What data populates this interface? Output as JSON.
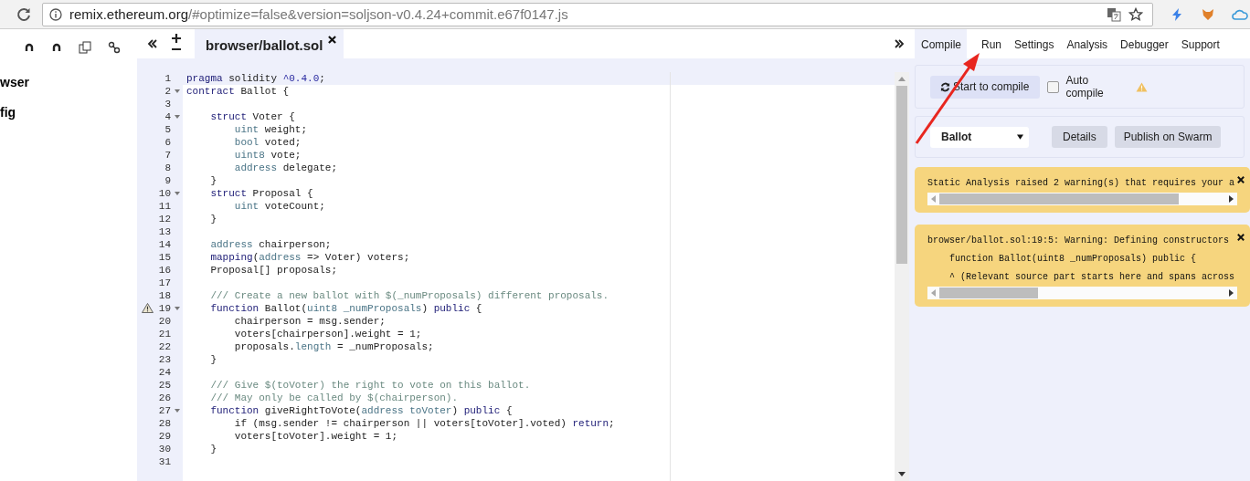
{
  "browser": {
    "url_host": "remix.ethereum.org",
    "url_rest": "/#optimize=false&version=soljson-v0.4.24+commit.e67f0147.js"
  },
  "file_explorer": {
    "items": [
      {
        "label": "wser"
      },
      {
        "label": "fig"
      }
    ]
  },
  "editor": {
    "tabs": [
      {
        "label": "browser/ballot.sol",
        "selected": true
      }
    ],
    "lines": [
      {
        "num": "1",
        "fold": false,
        "warning": false,
        "active": true,
        "segments": [
          {
            "text": "pragma",
            "kind": "kw"
          },
          {
            "text": " solidity ",
            "kind": "plain"
          },
          {
            "text": "^0.4.0",
            "kind": "num"
          },
          {
            "text": ";",
            "kind": "plain"
          }
        ]
      },
      {
        "num": "2",
        "fold": true,
        "warning": false,
        "active": false,
        "segments": [
          {
            "text": "contract",
            "kind": "kw"
          },
          {
            "text": " Ballot {",
            "kind": "plain"
          }
        ]
      },
      {
        "num": "3",
        "fold": false,
        "warning": false,
        "active": false
      },
      {
        "num": "4",
        "fold": true,
        "warning": false,
        "active": false,
        "segments": [
          {
            "text": "    struct",
            "kind": "kw"
          },
          {
            "text": " Voter {",
            "kind": "plain"
          }
        ]
      },
      {
        "num": "5",
        "fold": false,
        "warning": false,
        "active": false,
        "segments": [
          {
            "text": "        uint",
            "kind": "type"
          },
          {
            "text": " weight;",
            "kind": "plain"
          }
        ]
      },
      {
        "num": "6",
        "fold": false,
        "warning": false,
        "active": false,
        "segments": [
          {
            "text": "        bool",
            "kind": "type"
          },
          {
            "text": " voted;",
            "kind": "plain"
          }
        ]
      },
      {
        "num": "7",
        "fold": false,
        "warning": false,
        "active": false,
        "segments": [
          {
            "text": "        uint8",
            "kind": "type"
          },
          {
            "text": " vote;",
            "kind": "plain"
          }
        ]
      },
      {
        "num": "8",
        "fold": false,
        "warning": false,
        "active": false,
        "segments": [
          {
            "text": "        address",
            "kind": "type"
          },
          {
            "text": " delegate;",
            "kind": "plain"
          }
        ]
      },
      {
        "num": "9",
        "fold": false,
        "warning": false,
        "active": false,
        "segments": [
          {
            "text": "    }",
            "kind": "plain"
          }
        ]
      },
      {
        "num": "10",
        "fold": true,
        "warning": false,
        "active": false,
        "segments": [
          {
            "text": "    struct",
            "kind": "kw"
          },
          {
            "text": " Proposal {",
            "kind": "plain"
          }
        ]
      },
      {
        "num": "11",
        "fold": false,
        "warning": false,
        "active": false,
        "segments": [
          {
            "text": "        uint",
            "kind": "type"
          },
          {
            "text": " voteCount;",
            "kind": "plain"
          }
        ]
      },
      {
        "num": "12",
        "fold": false,
        "warning": false,
        "active": false,
        "segments": [
          {
            "text": "    }",
            "kind": "plain"
          }
        ]
      },
      {
        "num": "13",
        "fold": false,
        "warning": false,
        "active": false
      },
      {
        "num": "14",
        "fold": false,
        "warning": false,
        "active": false,
        "segments": [
          {
            "text": "    address",
            "kind": "type"
          },
          {
            "text": " chairperson;",
            "kind": "plain"
          }
        ]
      },
      {
        "num": "15",
        "fold": false,
        "warning": false,
        "active": false,
        "segments": [
          {
            "text": "    mapping",
            "kind": "kw"
          },
          {
            "text": "(",
            "kind": "plain"
          },
          {
            "text": "address",
            "kind": "type"
          },
          {
            "text": " => Voter) voters;",
            "kind": "plain"
          }
        ]
      },
      {
        "num": "16",
        "fold": false,
        "warning": false,
        "active": false,
        "segments": [
          {
            "text": "    Proposal[] proposals;",
            "kind": "plain"
          }
        ]
      },
      {
        "num": "17",
        "fold": false,
        "warning": false,
        "active": false
      },
      {
        "num": "18",
        "fold": false,
        "warning": false,
        "active": false,
        "segments": [
          {
            "text": "    /// Create a new ballot with $(_numProposals) different proposals.",
            "kind": "comment"
          }
        ]
      },
      {
        "num": "19",
        "fold": true,
        "warning": true,
        "active": false,
        "segments": [
          {
            "text": "    function",
            "kind": "kw"
          },
          {
            "text": " Ballot(",
            "kind": "plain"
          },
          {
            "text": "uint8 _numProposals",
            "kind": "type"
          },
          {
            "text": ") ",
            "kind": "plain"
          },
          {
            "text": "public",
            "kind": "kw"
          },
          {
            "text": " {",
            "kind": "plain"
          }
        ]
      },
      {
        "num": "20",
        "fold": false,
        "warning": false,
        "active": false,
        "segments": [
          {
            "text": "        chairperson = msg.sender;",
            "kind": "plain"
          }
        ]
      },
      {
        "num": "21",
        "fold": false,
        "warning": false,
        "active": false,
        "segments": [
          {
            "text": "        voters[chairperson].weight = 1;",
            "kind": "plain"
          }
        ]
      },
      {
        "num": "22",
        "fold": false,
        "warning": false,
        "active": false,
        "segments": [
          {
            "text": "        proposals.",
            "kind": "plain"
          },
          {
            "text": "length",
            "kind": "type"
          },
          {
            "text": " = _numProposals;",
            "kind": "plain"
          }
        ]
      },
      {
        "num": "23",
        "fold": false,
        "warning": false,
        "active": false,
        "segments": [
          {
            "text": "    }",
            "kind": "plain"
          }
        ]
      },
      {
        "num": "24",
        "fold": false,
        "warning": false,
        "active": false
      },
      {
        "num": "25",
        "fold": false,
        "warning": false,
        "active": false,
        "segments": [
          {
            "text": "    /// Give $(toVoter) the right to vote on this ballot.",
            "kind": "comment"
          }
        ]
      },
      {
        "num": "26",
        "fold": false,
        "warning": false,
        "active": false,
        "segments": [
          {
            "text": "    /// May only be called by $(chairperson).",
            "kind": "comment"
          }
        ]
      },
      {
        "num": "27",
        "fold": true,
        "warning": false,
        "active": false,
        "segments": [
          {
            "text": "    function",
            "kind": "kw"
          },
          {
            "text": " giveRightToVote(",
            "kind": "plain"
          },
          {
            "text": "address toVoter",
            "kind": "type"
          },
          {
            "text": ") ",
            "kind": "plain"
          },
          {
            "text": "public",
            "kind": "kw"
          },
          {
            "text": " {",
            "kind": "plain"
          }
        ]
      },
      {
        "num": "28",
        "fold": false,
        "warning": false,
        "active": false,
        "segments": [
          {
            "text": "        if (msg.sender != chairperson || voters[toVoter].voted) ",
            "kind": "plain"
          },
          {
            "text": "return",
            "kind": "kw"
          },
          {
            "text": ";",
            "kind": "plain"
          }
        ]
      },
      {
        "num": "29",
        "fold": false,
        "warning": false,
        "active": false,
        "segments": [
          {
            "text": "        voters[toVoter].weight = 1;",
            "kind": "plain"
          }
        ]
      },
      {
        "num": "30",
        "fold": false,
        "warning": false,
        "active": false,
        "segments": [
          {
            "text": "    }",
            "kind": "plain"
          }
        ]
      },
      {
        "num": "31",
        "fold": false,
        "warning": false,
        "active": false
      }
    ]
  },
  "panel": {
    "tabs": [
      {
        "label": "Compile",
        "selected": true
      },
      {
        "label": "Run",
        "selected": false
      },
      {
        "label": "Settings",
        "selected": false
      },
      {
        "label": "Analysis",
        "selected": false
      },
      {
        "label": "Debugger",
        "selected": false
      },
      {
        "label": "Support",
        "selected": false
      }
    ],
    "compile_button": "Start to compile",
    "auto_compile": {
      "label": "Auto compile",
      "checked": false
    },
    "contract_select": "Ballot",
    "buttons": [
      "Details",
      "Publish on Swarm"
    ],
    "warnings": [
      {
        "lines": [
          "Static Analysis raised 2 warning(s) that requires your a"
        ]
      },
      {
        "lines": [
          "browser/ballot.sol:19:5: Warning: Defining constructors",
          "    function Ballot(uint8 _numProposals) public {",
          "    ^ (Relevant source part starts here and spans across"
        ]
      }
    ]
  }
}
